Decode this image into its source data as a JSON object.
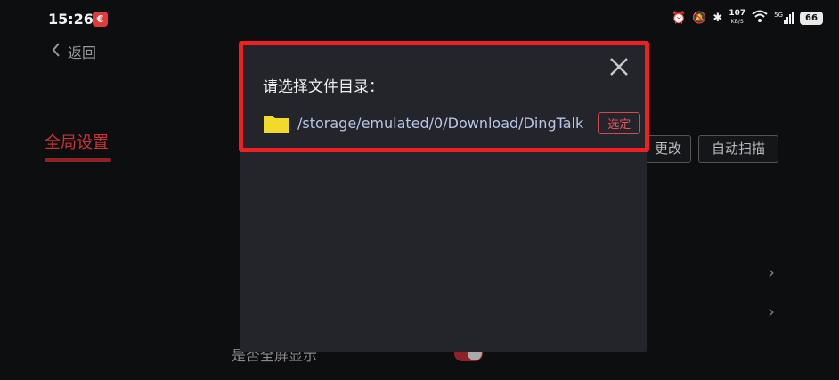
{
  "status_bar": {
    "time": "15:26",
    "app_badge": "€",
    "net_speed": "107",
    "net_unit": "KB/S",
    "signal": "5G",
    "battery": "66"
  },
  "page": {
    "back_label": "返回",
    "sidebar_active": "全局设置",
    "buttons": {
      "change": "更改",
      "auto_scan": "自动扫描"
    },
    "rows": {
      "last": "是否全屏显示"
    }
  },
  "dialog": {
    "title": "请选择文件目录：",
    "path": "/storage/emulated/0/Download/DingTalk",
    "select_label": "选定"
  },
  "colors": {
    "accent": "#c7343a",
    "highlight": "#f01f24",
    "folder": "#f2d92c"
  }
}
